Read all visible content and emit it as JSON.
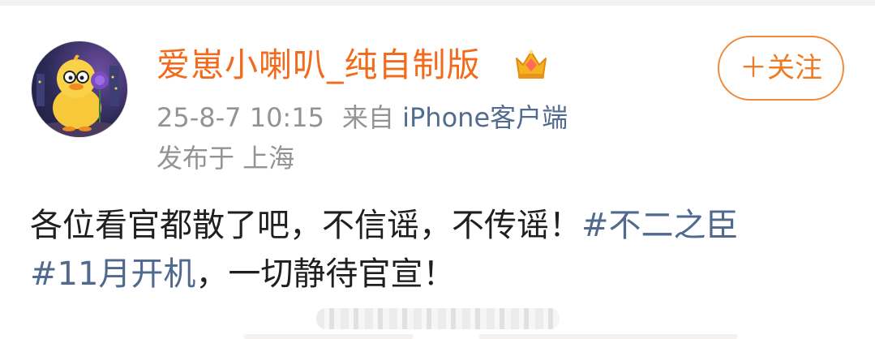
{
  "post": {
    "author": {
      "name": "爱崽小喇叭_纯自制版",
      "avatar_icon": "duck-avatar",
      "badge_icon": "crown-icon"
    },
    "meta": {
      "timestamp": "25-8-7 10:15",
      "source_prefix": "来自",
      "source_app": "iPhone客户端",
      "location": "发布于 上海"
    },
    "follow_button": "＋关注",
    "content": {
      "line1_text": "各位看官都散了吧，不信谣，不传谣！",
      "line1_hashtag": "#不二之臣",
      "line2_hashtag": "#11月开机",
      "line2_text": "，一切静待官宣！"
    }
  },
  "colors": {
    "username": "#f26a1b",
    "follow_border": "#f08a3a",
    "hashtag": "#50698f",
    "meta_gray": "#939393",
    "source_link": "#526c8f",
    "body_text": "#1f1f1f"
  }
}
